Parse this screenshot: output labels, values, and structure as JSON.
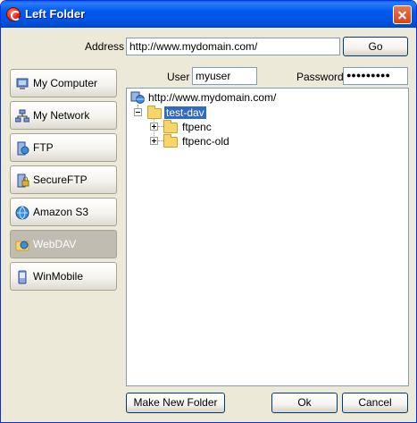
{
  "window": {
    "title": "Left Folder"
  },
  "address": {
    "label": "Address",
    "value": "http://www.mydomain.com/",
    "go_label": "Go"
  },
  "credentials": {
    "user_label": "User",
    "user_value": "myuser",
    "password_label": "Password",
    "password_value": "●●●●●●●●●"
  },
  "sidebar": {
    "items": [
      {
        "label": "My Computer",
        "icon": "computer-icon"
      },
      {
        "label": "My Network",
        "icon": "network-icon"
      },
      {
        "label": "FTP",
        "icon": "ftp-icon"
      },
      {
        "label": "SecureFTP",
        "icon": "secureftp-icon"
      },
      {
        "label": "Amazon S3",
        "icon": "amazon-s3-icon"
      },
      {
        "label": "WebDAV",
        "icon": "webdav-icon",
        "active": true
      },
      {
        "label": "WinMobile",
        "icon": "winmobile-icon"
      }
    ]
  },
  "tree": {
    "root": "http://www.mydomain.com/",
    "selected": "test-dav",
    "children": [
      "ftpenc",
      "ftpenc-old"
    ]
  },
  "buttons": {
    "make_folder": "Make New Folder",
    "ok": "Ok",
    "cancel": "Cancel"
  },
  "colors": {
    "titlebar": "#0058ee",
    "selection": "#316ac5",
    "dialog_bg": "#ece9d8"
  }
}
